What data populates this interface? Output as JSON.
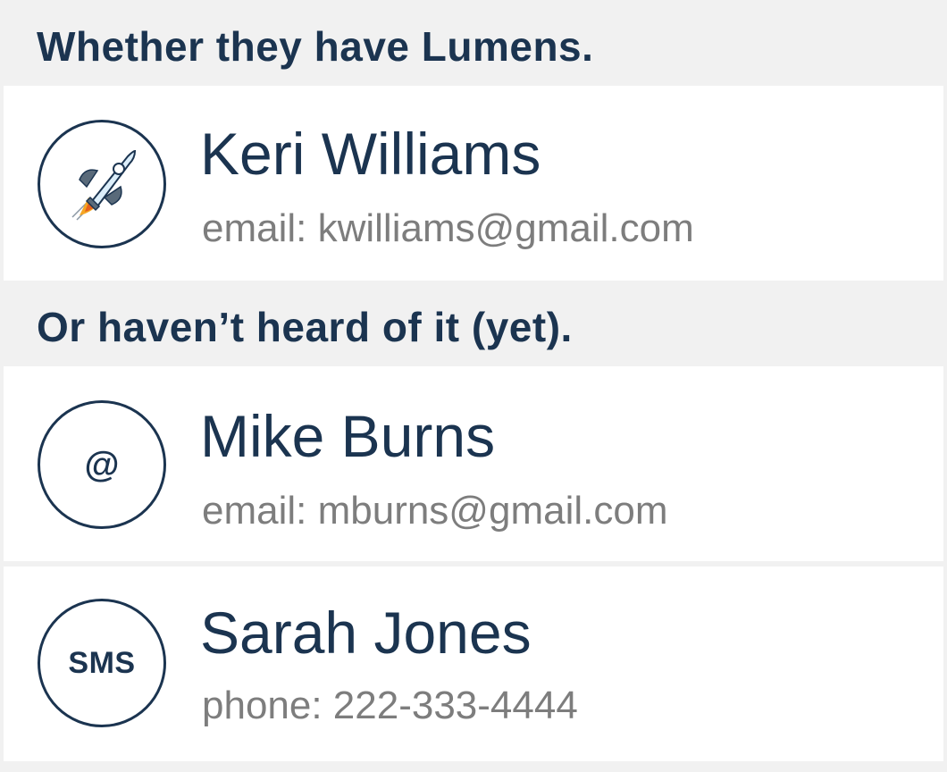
{
  "sections": [
    {
      "header": "Whether they have Lumens.",
      "contacts": [
        {
          "name": "Keri Williams",
          "detail": "email: kwilliams@gmail.com",
          "icon": "rocket-icon"
        }
      ]
    },
    {
      "header": "Or haven’t heard of it (yet).",
      "contacts": [
        {
          "name": "Mike Burns",
          "detail": "email: mburns@gmail.com",
          "icon": "at-icon",
          "icon_text": "@"
        },
        {
          "name": "Sarah Jones",
          "detail": "phone: 222-333-4444",
          "icon": "sms-icon",
          "icon_text": "SMS"
        }
      ]
    }
  ],
  "colors": {
    "navy": "#1b3450",
    "gray_text": "#7d7d7d",
    "background": "#f1f1f1",
    "card": "#ffffff",
    "rocket_body": "#dceefa",
    "rocket_fin": "#596a7a",
    "flame_orange": "#f5a623",
    "flame_red": "#e6601c"
  }
}
